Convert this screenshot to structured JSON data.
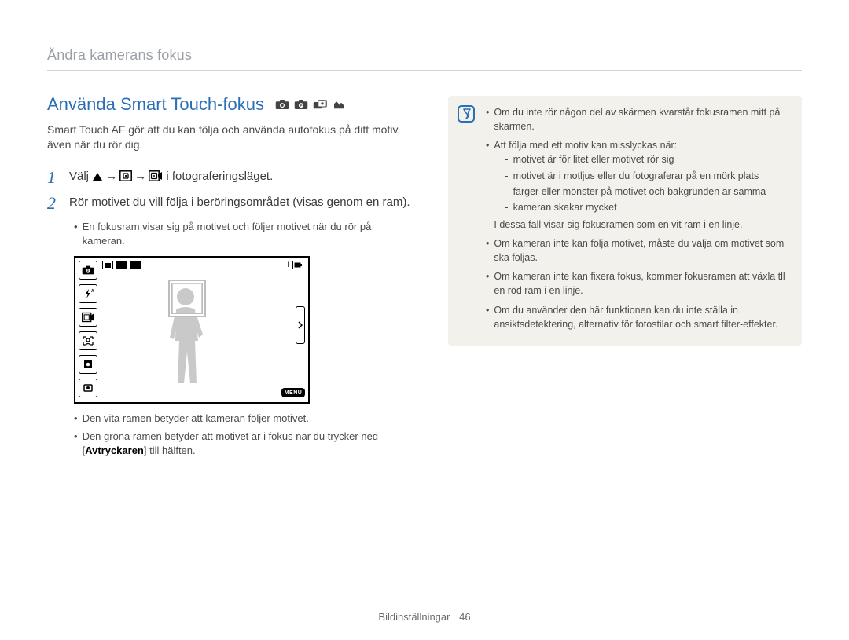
{
  "breadcrumb": "Ändra kamerans fokus",
  "title": "Använda Smart Touch-fokus",
  "mode_icons": [
    "camera-mode-icon",
    "camera-mode-icon",
    "dual-mode-icon",
    "scene-mode-icon"
  ],
  "intro": "Smart Touch AF gör att du kan följa och använda autofokus på ditt motiv, även när du rör dig.",
  "steps": {
    "s1": {
      "num": "1",
      "prefix": "Välj ",
      "arrow": "→",
      "suffix": " i fotograferingsläget."
    },
    "s2": {
      "num": "2",
      "text": "Rör motivet du vill följa i beröringsområdet (visas genom en ram)."
    }
  },
  "step2_sub1": "En fokusram visar sig på motivet och följer motivet när du rör på kameran.",
  "preview": {
    "menu_label": "MENU"
  },
  "after_preview": {
    "a": "Den vita ramen betyder att kameran följer motivet.",
    "b_pre": "Den gröna ramen betyder att motivet är i fokus när du trycker ned [",
    "b_bold": "Avtryckaren",
    "b_post": "] till hälften."
  },
  "notes": {
    "n1": "Om du inte rör någon del av skärmen kvarstår fokusramen mitt på skärmen.",
    "n2": "Att följa med ett motiv kan misslyckas när:",
    "n2_subs": {
      "a": "motivet är för litet eller motivet rör sig",
      "b": "motivet är i motljus eller du fotograferar på en mörk plats",
      "c": "färger eller mönster på motivet och bakgrunden är samma",
      "d": "kameran skakar mycket"
    },
    "n2_tail": "I dessa fall visar sig fokusramen som en vit ram i en linje.",
    "n3": "Om kameran inte kan följa motivet, måste du välja om motivet som ska följas.",
    "n4": "Om kameran inte kan fixera fokus, kommer fokusramen att växla tll en röd ram i en linje.",
    "n5": "Om du använder den här funktionen kan du inte ställa in ansiktsdetektering, alternativ för fotostilar och smart filter-effekter."
  },
  "footer": {
    "section": "Bildinställningar",
    "page": "46"
  }
}
